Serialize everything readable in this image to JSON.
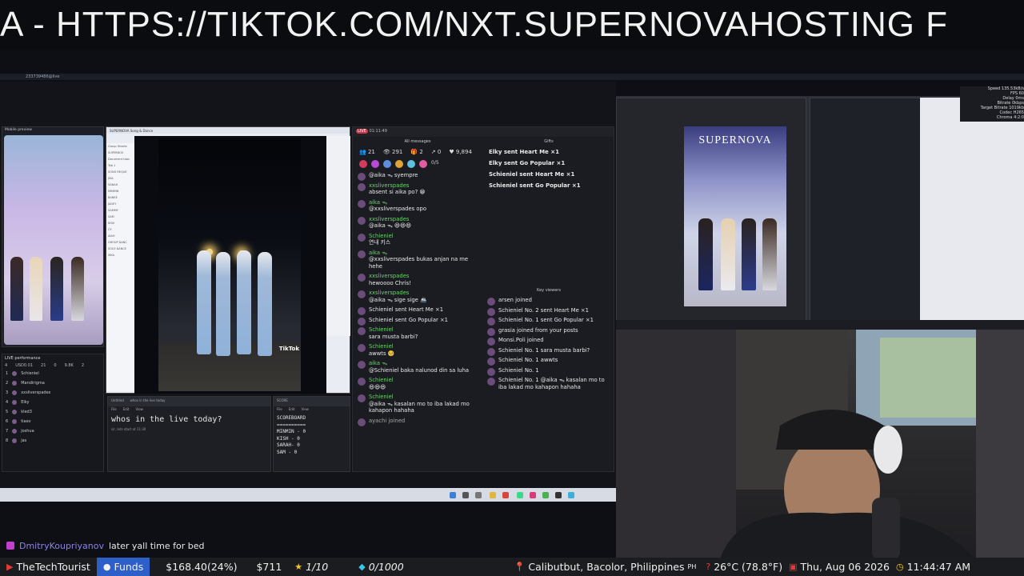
{
  "banner": {
    "text": "A - HTTPS://TIKTOK.COM/NXT.SUPERNOVAHOSTING F"
  },
  "topbar": {
    "label": "233739486@live"
  },
  "mobile": {
    "title": "Mobile preview"
  },
  "live_performance": {
    "title": "LIVE performance",
    "stats": [
      "4",
      "USD0.01",
      "21",
      "0",
      "9.8K",
      "2"
    ],
    "rows": [
      {
        "rank": "1",
        "name": "Schieniel"
      },
      {
        "rank": "2",
        "name": "Mandirigma"
      },
      {
        "rank": "3",
        "name": "xxsliverspades"
      },
      {
        "rank": "4",
        "name": "Elky"
      },
      {
        "rank": "5",
        "name": "kled3"
      },
      {
        "rank": "6",
        "name": "tiaev"
      },
      {
        "rank": "7",
        "name": "joshua"
      },
      {
        "rank": "8",
        "name": "jas"
      }
    ]
  },
  "doc": {
    "title": "SUPERNOVA Song & Dance",
    "side_items": [
      "Group Sheets",
      "SUPERNOV",
      "Document tabs",
      "Tab 1",
      "SONG REQUE",
      "JIKA",
      "SANAH",
      "MINMIN",
      "BANEE",
      "JAGEY",
      "SAMMY",
      "SAM",
      "KISH",
      "CY",
      "AIAH",
      "GROUP DANC",
      "SOLO DANCE",
      "XIKA"
    ]
  },
  "video": {
    "watermark": "TikTok"
  },
  "notepad1": {
    "tab": "Untitled",
    "tab2": "whos in the live today",
    "menu": [
      "File",
      "Edit",
      "View"
    ],
    "text": "whos in the live today?",
    "sub": "sir, lets start at 11:30"
  },
  "notepad2": {
    "tab": "SCORE",
    "menu": [
      "File",
      "Edit",
      "View"
    ],
    "text": "SCOREBOARD\n==========\nMINMIN - 0\nKISH - 0\nSARAH- 0\nSAM - 0"
  },
  "chat": {
    "live_label": "LIVE",
    "time": "01:11:49",
    "all_messages_title": "All messages",
    "gifts_title": "Gifts",
    "key_viewers_title": "Key viewers",
    "stats": [
      "21",
      "291",
      "2",
      "0",
      "9,894"
    ],
    "progress": "0/5",
    "messages": [
      {
        "who": "",
        "text": "@aika ᯓ syempre"
      },
      {
        "who": "xxsliverspades",
        "text": "absent si aika po? 😁"
      },
      {
        "who": "aika ᯓ",
        "text": "@xxsliverspades opo"
      },
      {
        "who": "xxsliverspades",
        "text": "@aika ᯓ 😆😆😆"
      },
      {
        "who": "Schieniel",
        "text": "연내 키스"
      },
      {
        "who": "aika ᯓ",
        "text": "@xxsliverspades bukas anjan na me hehe"
      },
      {
        "who": "xxsliverspades",
        "text": "hewoooo Chris!"
      },
      {
        "who": "xxsliverspades",
        "text": "@aika ᯓ sige sige 🚢"
      },
      {
        "who": "",
        "text": "Schieniel sent Heart Me ×1"
      },
      {
        "who": "",
        "text": "Schieniel sent Go Popular ×1"
      },
      {
        "who": "Schieniel",
        "text": "sara musta barbi?"
      },
      {
        "who": "Schieniel",
        "text": "awwts 🥺"
      },
      {
        "who": "aika ᯓ",
        "text": "@Schieniel baka nalunod din sa luha"
      },
      {
        "who": "Schieniel",
        "text": "😆😆😆"
      },
      {
        "who": "Schieniel",
        "text": "@aika ᯓ kasalan mo to iba lakad mo kahapon hahaha"
      },
      {
        "who": "",
        "text": "ayachi joined"
      }
    ],
    "gifts": [
      "Elky sent Heart Me ×1",
      "Elky sent Go Popular ×1",
      "Schieniel sent Heart Me ×1",
      "Schieniel sent Go Popular ×1"
    ],
    "key_viewers": [
      "arsen  joined",
      "Schieniel No. 2 sent Heart Me ×1",
      "Schieniel No. 1 sent Go Popular ×1",
      "grasia  joined from your posts",
      "Monsi.Poli  joined",
      "Schieniel No. 1 sara musta barbi?",
      "Schieniel No. 1 awwts",
      "Schieniel No. 1",
      "Schieniel No. 1 @aika ᯓ kasalan mo to iba lakad mo kahapon hahaha"
    ]
  },
  "obs": {
    "preview_title": "SUPERNOVA"
  },
  "stream_stats": {
    "lines": [
      "Speed 135.53kB/s",
      "FPS 60",
      "Delay 0ms",
      "Bitrate 0kbps",
      "Target Bitrate 1019kb",
      "Codec H265",
      "Chroma 4:2:0"
    ]
  },
  "chatline": {
    "user": "DmitryKoupriyanov",
    "text": "later yall time for bed"
  },
  "bottombar": {
    "channel": "TheTechTourist",
    "funds": "Funds",
    "amount": "$168.40(24%)",
    "amount2": "$711",
    "stars": "1/10",
    "gems": "0/1000",
    "location": "Calibutbut, Bacolor, Philippines",
    "country_code": "PH",
    "weather": "26°C (78.8°F)",
    "date": "Thu, Aug 06 2026",
    "time": "11:44:47 AM"
  }
}
